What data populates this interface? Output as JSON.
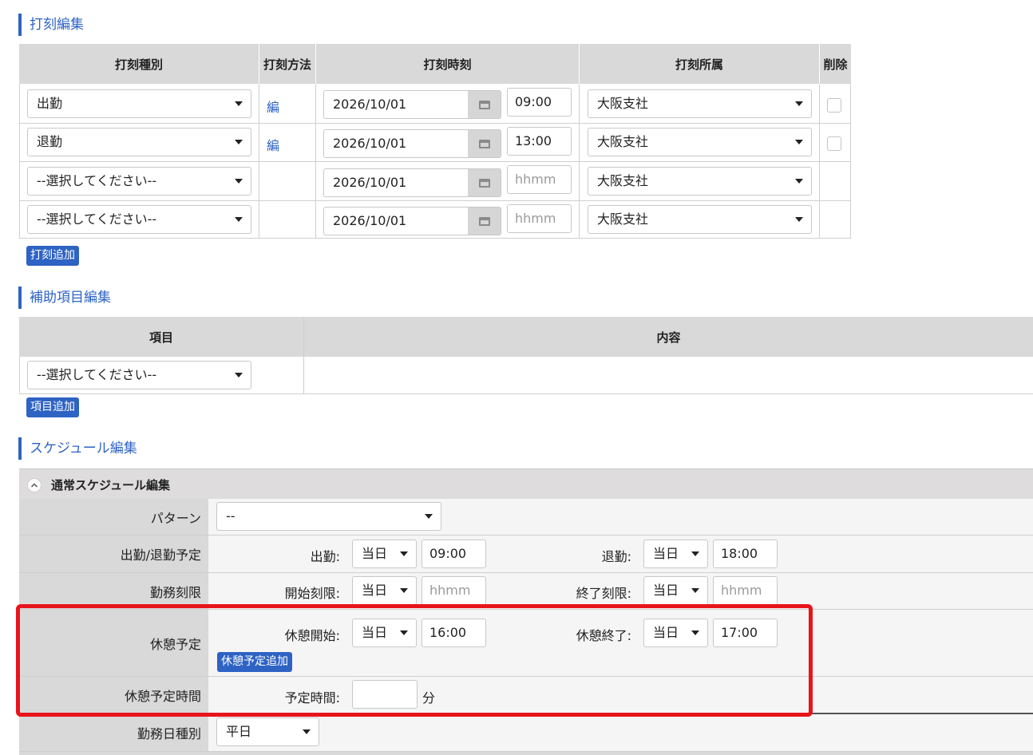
{
  "punch": {
    "section_title": "打刻編集",
    "headers": {
      "type": "打刻種別",
      "method": "打刻方法",
      "time": "打刻時刻",
      "affil": "打刻所属",
      "delete": "削除"
    },
    "rows": [
      {
        "type": "出勤",
        "method": "編",
        "date": "2026/10/01",
        "time": "09:00",
        "time_placeholder": false,
        "affil": "大阪支社",
        "has_checkbox": true
      },
      {
        "type": "退勤",
        "method": "編",
        "date": "2026/10/01",
        "time": "13:00",
        "time_placeholder": false,
        "affil": "大阪支社",
        "has_checkbox": true
      },
      {
        "type": "--選択してください--",
        "method": "",
        "date": "2026/10/01",
        "time": "hhmm",
        "time_placeholder": true,
        "affil": "大阪支社",
        "has_checkbox": false
      },
      {
        "type": "--選択してください--",
        "method": "",
        "date": "2026/10/01",
        "time": "hhmm",
        "time_placeholder": true,
        "affil": "大阪支社",
        "has_checkbox": false
      }
    ],
    "add_button": "打刻追加"
  },
  "aux": {
    "section_title": "補助項目編集",
    "headers": {
      "item": "項目",
      "content": "内容"
    },
    "row_select": "--選択してください--",
    "add_button": "項目追加"
  },
  "schedule": {
    "section_title": "スケジュール編集",
    "panel_title": "通常スケジュール編集",
    "pattern": {
      "label": "パターン",
      "value": "--"
    },
    "work": {
      "label": "出勤/退勤予定",
      "start_label": "出勤:",
      "start_day": "当日",
      "start_time": "09:00",
      "end_label": "退勤:",
      "end_day": "当日",
      "end_time": "18:00"
    },
    "limit": {
      "label": "勤務刻限",
      "start_label": "開始刻限:",
      "start_day": "当日",
      "start_time": "hhmm",
      "end_label": "終了刻限:",
      "end_day": "当日",
      "end_time": "hhmm"
    },
    "break": {
      "label": "休憩予定",
      "start_label": "休憩開始:",
      "start_day": "当日",
      "start_time": "16:00",
      "end_label": "休憩終了:",
      "end_day": "当日",
      "end_time": "17:00",
      "add_button": "休憩予定追加"
    },
    "break_time": {
      "label": "休憩予定時間",
      "field_label": "予定時間:",
      "value": "",
      "unit": "分"
    },
    "day_type": {
      "label": "勤務日種別",
      "value": "平日"
    }
  },
  "colors": {
    "accent": "#2e63c4",
    "highlight": "#e8141b",
    "header_bg": "#d9d9d9"
  }
}
